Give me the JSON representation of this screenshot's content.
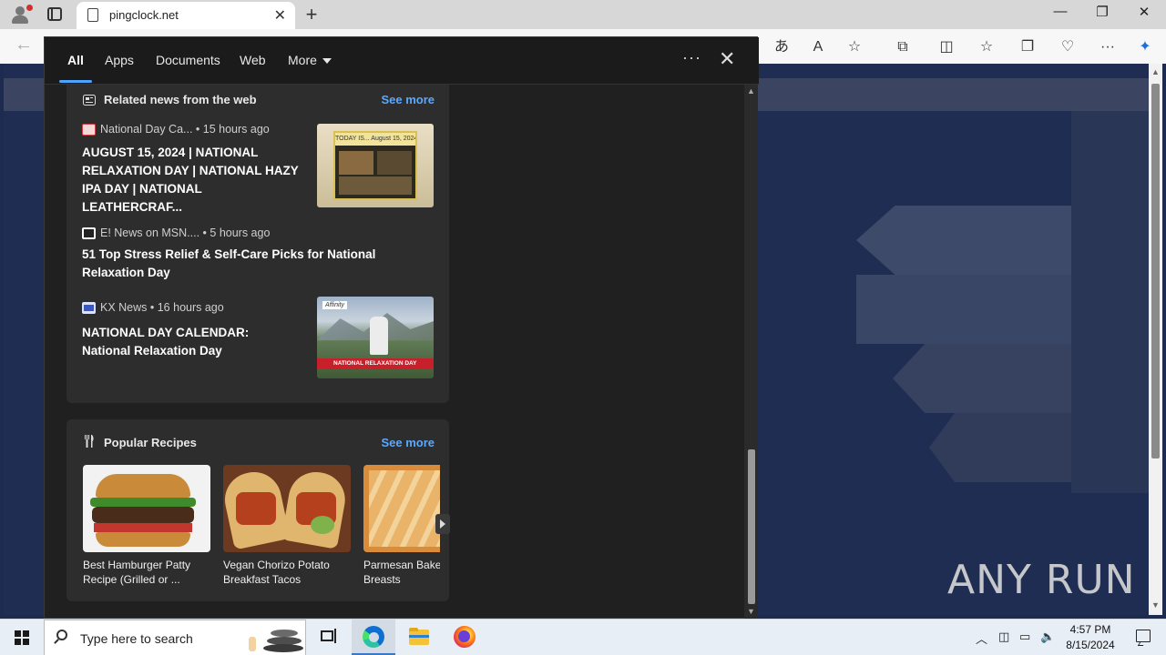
{
  "browser": {
    "tab_title": "pingclock.net",
    "close_tab": "✕",
    "new_tab": "+",
    "window_controls": {
      "minimize": "—",
      "restore": "❐",
      "close": "✕"
    },
    "back": "←"
  },
  "flyout": {
    "tabs": [
      {
        "label": "All",
        "active": true
      },
      {
        "label": "Apps"
      },
      {
        "label": "Documents"
      },
      {
        "label": "Web"
      },
      {
        "label": "More"
      }
    ],
    "more_options": "···",
    "close": "✕",
    "news_card": {
      "title": "Related news from the web",
      "see_more": "See more",
      "items": [
        {
          "source": "National Day Ca...",
          "age": "15 hours ago",
          "headline": "AUGUST 15, 2024 | NATIONAL RELAXATION DAY | NATIONAL HAZY IPA DAY | NATIONAL LEATHERCRAF...",
          "thumb_text": "TODAY IS... August 15, 2024"
        },
        {
          "source": "E! News on MSN....",
          "age": "5 hours ago",
          "headline": "51 Top Stress Relief & Self-Care Picks for National Relaxation Day"
        },
        {
          "source": "KX News",
          "age": "16 hours ago",
          "headline": "NATIONAL DAY CALENDAR: National Relaxation Day",
          "thumb_text": "NATIONAL RELAXATION DAY",
          "thumb_logo": "Affinity"
        }
      ]
    },
    "recipes_card": {
      "title": "Popular Recipes",
      "see_more": "See more",
      "items": [
        {
          "name": "Best Hamburger Patty Recipe (Grilled or ..."
        },
        {
          "name": "Vegan Chorizo Potato Breakfast Tacos"
        },
        {
          "name": "Parmesan Baked Chicken Breasts"
        }
      ]
    }
  },
  "page": {
    "watermark": "ANY RUN"
  },
  "taskbar": {
    "search_placeholder": "Type here to search",
    "time": "4:57 PM",
    "date": "8/15/2024"
  },
  "colors": {
    "accent": "#4ea3ff",
    "flyout_bg": "#202020",
    "card_bg": "#2d2d2d",
    "page_bg": "#1f2d52"
  }
}
